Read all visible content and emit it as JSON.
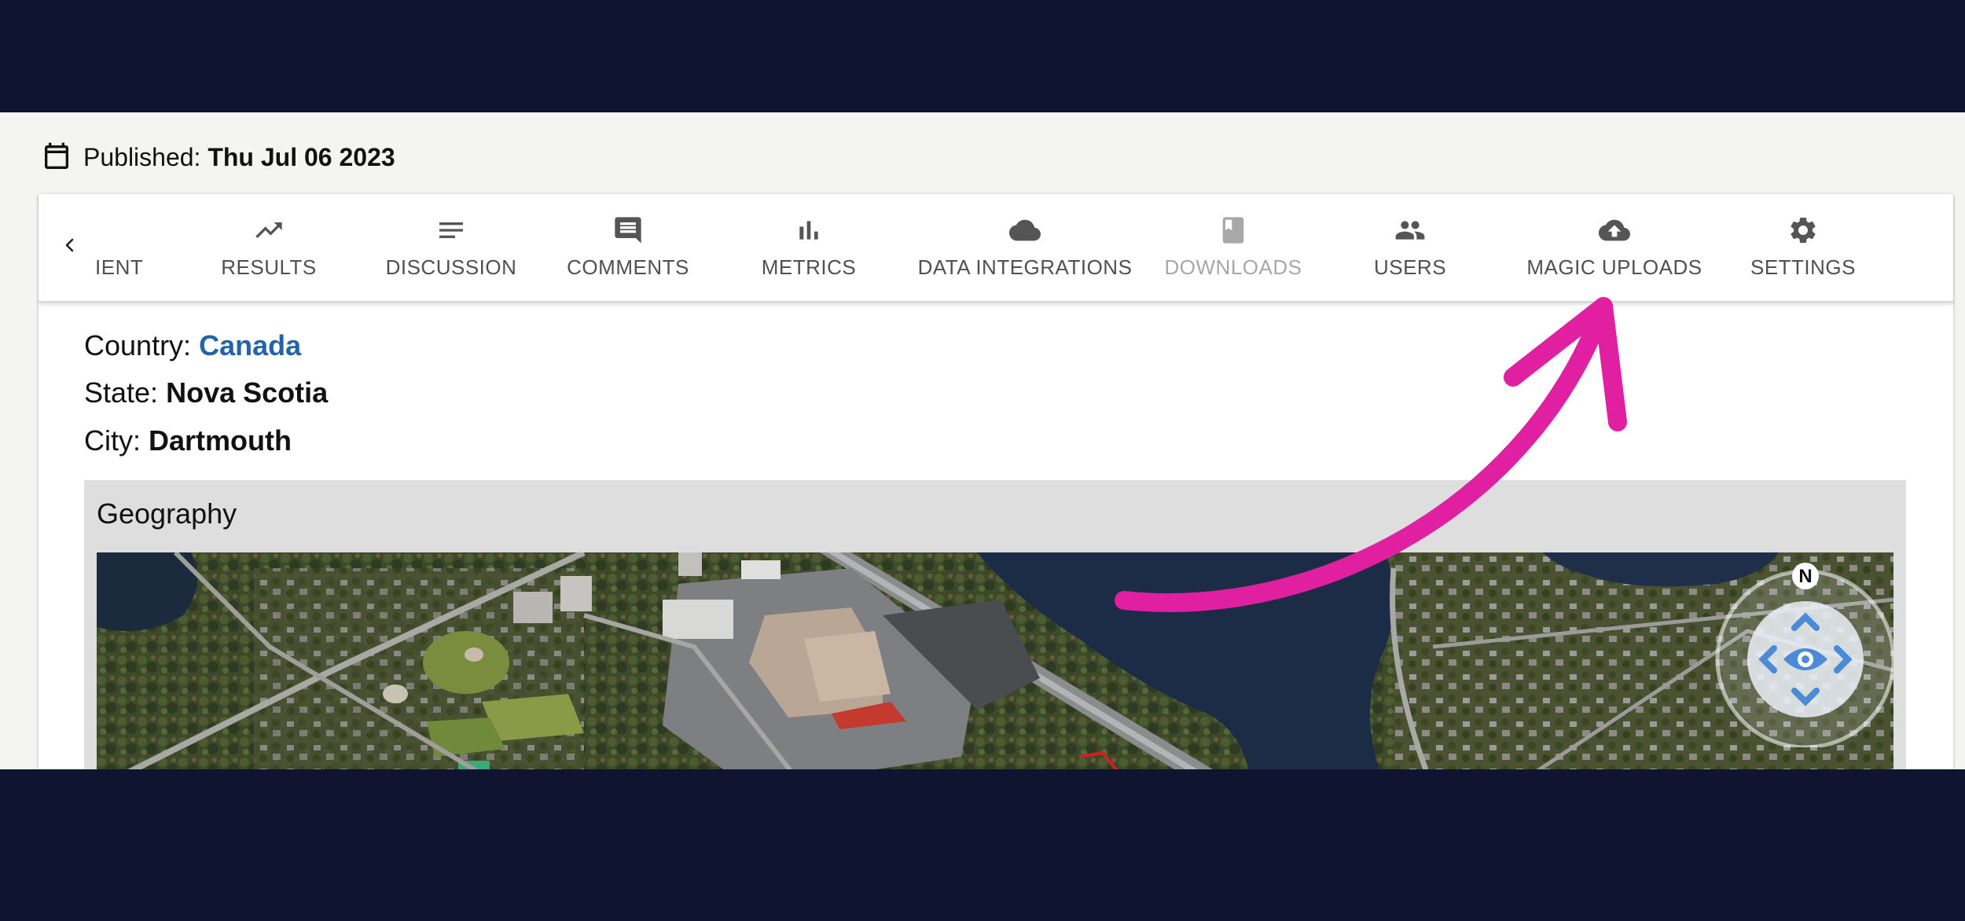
{
  "published": {
    "label": "Published:",
    "date": "Thu Jul 06 2023"
  },
  "tabs": [
    {
      "label": "IENT",
      "icon": "none",
      "disabled": false
    },
    {
      "label": "RESULTS",
      "icon": "trending-up-icon",
      "disabled": false
    },
    {
      "label": "DISCUSSION",
      "icon": "notes-icon",
      "disabled": false
    },
    {
      "label": "COMMENTS",
      "icon": "comment-icon",
      "disabled": false
    },
    {
      "label": "METRICS",
      "icon": "bar-chart-icon",
      "disabled": false
    },
    {
      "label": "DATA INTEGRATIONS",
      "icon": "cloud-icon",
      "disabled": false
    },
    {
      "label": "DOWNLOADS",
      "icon": "book-icon",
      "disabled": true
    },
    {
      "label": "USERS",
      "icon": "people-icon",
      "disabled": false
    },
    {
      "label": "MAGIC UPLOADS",
      "icon": "cloud-upload-icon",
      "disabled": false
    },
    {
      "label": "SETTINGS",
      "icon": "gear-icon",
      "disabled": false
    }
  ],
  "location": {
    "country_label": "Country:",
    "country": "Canada",
    "state_label": "State:",
    "state": "Nova Scotia",
    "city_label": "City:",
    "city": "Dartmouth"
  },
  "geography": {
    "title": "Geography",
    "compass_label": "N"
  },
  "colors": {
    "page_background": "#0f1431",
    "link": "#2563a8",
    "annotation_arrow": "#e020a0",
    "nav_control": "#4a8ad6"
  }
}
